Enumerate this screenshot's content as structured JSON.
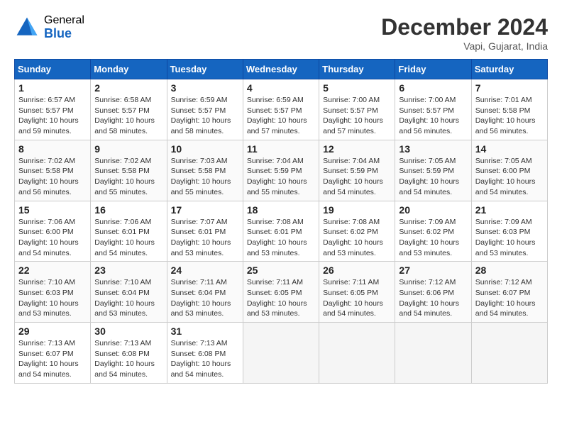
{
  "header": {
    "logo_general": "General",
    "logo_blue": "Blue",
    "month_title": "December 2024",
    "location": "Vapi, Gujarat, India"
  },
  "calendar": {
    "days_of_week": [
      "Sunday",
      "Monday",
      "Tuesday",
      "Wednesday",
      "Thursday",
      "Friday",
      "Saturday"
    ],
    "weeks": [
      [
        {
          "day": "1",
          "sunrise": "6:57 AM",
          "sunset": "5:57 PM",
          "daylight": "10 hours and 59 minutes."
        },
        {
          "day": "2",
          "sunrise": "6:58 AM",
          "sunset": "5:57 PM",
          "daylight": "10 hours and 58 minutes."
        },
        {
          "day": "3",
          "sunrise": "6:59 AM",
          "sunset": "5:57 PM",
          "daylight": "10 hours and 58 minutes."
        },
        {
          "day": "4",
          "sunrise": "6:59 AM",
          "sunset": "5:57 PM",
          "daylight": "10 hours and 57 minutes."
        },
        {
          "day": "5",
          "sunrise": "7:00 AM",
          "sunset": "5:57 PM",
          "daylight": "10 hours and 57 minutes."
        },
        {
          "day": "6",
          "sunrise": "7:00 AM",
          "sunset": "5:57 PM",
          "daylight": "10 hours and 56 minutes."
        },
        {
          "day": "7",
          "sunrise": "7:01 AM",
          "sunset": "5:58 PM",
          "daylight": "10 hours and 56 minutes."
        }
      ],
      [
        {
          "day": "8",
          "sunrise": "7:02 AM",
          "sunset": "5:58 PM",
          "daylight": "10 hours and 56 minutes."
        },
        {
          "day": "9",
          "sunrise": "7:02 AM",
          "sunset": "5:58 PM",
          "daylight": "10 hours and 55 minutes."
        },
        {
          "day": "10",
          "sunrise": "7:03 AM",
          "sunset": "5:58 PM",
          "daylight": "10 hours and 55 minutes."
        },
        {
          "day": "11",
          "sunrise": "7:04 AM",
          "sunset": "5:59 PM",
          "daylight": "10 hours and 55 minutes."
        },
        {
          "day": "12",
          "sunrise": "7:04 AM",
          "sunset": "5:59 PM",
          "daylight": "10 hours and 54 minutes."
        },
        {
          "day": "13",
          "sunrise": "7:05 AM",
          "sunset": "5:59 PM",
          "daylight": "10 hours and 54 minutes."
        },
        {
          "day": "14",
          "sunrise": "7:05 AM",
          "sunset": "6:00 PM",
          "daylight": "10 hours and 54 minutes."
        }
      ],
      [
        {
          "day": "15",
          "sunrise": "7:06 AM",
          "sunset": "6:00 PM",
          "daylight": "10 hours and 54 minutes."
        },
        {
          "day": "16",
          "sunrise": "7:06 AM",
          "sunset": "6:01 PM",
          "daylight": "10 hours and 54 minutes."
        },
        {
          "day": "17",
          "sunrise": "7:07 AM",
          "sunset": "6:01 PM",
          "daylight": "10 hours and 53 minutes."
        },
        {
          "day": "18",
          "sunrise": "7:08 AM",
          "sunset": "6:01 PM",
          "daylight": "10 hours and 53 minutes."
        },
        {
          "day": "19",
          "sunrise": "7:08 AM",
          "sunset": "6:02 PM",
          "daylight": "10 hours and 53 minutes."
        },
        {
          "day": "20",
          "sunrise": "7:09 AM",
          "sunset": "6:02 PM",
          "daylight": "10 hours and 53 minutes."
        },
        {
          "day": "21",
          "sunrise": "7:09 AM",
          "sunset": "6:03 PM",
          "daylight": "10 hours and 53 minutes."
        }
      ],
      [
        {
          "day": "22",
          "sunrise": "7:10 AM",
          "sunset": "6:03 PM",
          "daylight": "10 hours and 53 minutes."
        },
        {
          "day": "23",
          "sunrise": "7:10 AM",
          "sunset": "6:04 PM",
          "daylight": "10 hours and 53 minutes."
        },
        {
          "day": "24",
          "sunrise": "7:11 AM",
          "sunset": "6:04 PM",
          "daylight": "10 hours and 53 minutes."
        },
        {
          "day": "25",
          "sunrise": "7:11 AM",
          "sunset": "6:05 PM",
          "daylight": "10 hours and 53 minutes."
        },
        {
          "day": "26",
          "sunrise": "7:11 AM",
          "sunset": "6:05 PM",
          "daylight": "10 hours and 54 minutes."
        },
        {
          "day": "27",
          "sunrise": "7:12 AM",
          "sunset": "6:06 PM",
          "daylight": "10 hours and 54 minutes."
        },
        {
          "day": "28",
          "sunrise": "7:12 AM",
          "sunset": "6:07 PM",
          "daylight": "10 hours and 54 minutes."
        }
      ],
      [
        {
          "day": "29",
          "sunrise": "7:13 AM",
          "sunset": "6:07 PM",
          "daylight": "10 hours and 54 minutes."
        },
        {
          "day": "30",
          "sunrise": "7:13 AM",
          "sunset": "6:08 PM",
          "daylight": "10 hours and 54 minutes."
        },
        {
          "day": "31",
          "sunrise": "7:13 AM",
          "sunset": "6:08 PM",
          "daylight": "10 hours and 54 minutes."
        },
        null,
        null,
        null,
        null
      ]
    ]
  }
}
